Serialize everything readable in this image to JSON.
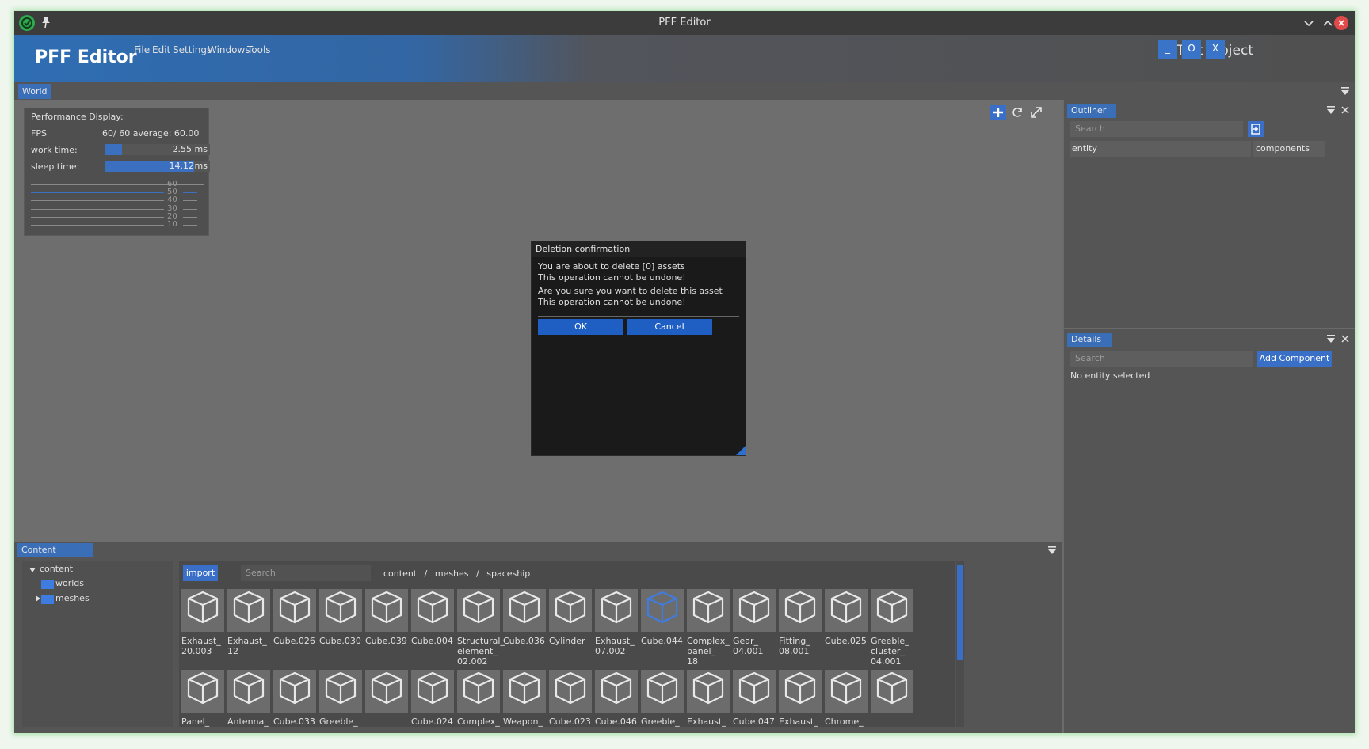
{
  "window": {
    "title": "PFF Editor"
  },
  "header": {
    "brand": "PFF Editor",
    "menu": [
      "File",
      "Edit",
      "Settings",
      "Windows",
      "Tools"
    ],
    "project": "Test Project",
    "buttons": {
      "minimize": "_",
      "maximize": "O",
      "close": "X"
    }
  },
  "world_tab": "World",
  "perf": {
    "title": "Performance Display:",
    "fps_label": "FPS",
    "fps_value": "60/  60   average: 60.00",
    "work_label": "work time:",
    "work_value": "2.55 ms",
    "work_fraction": 0.16,
    "sleep_label": "sleep time:",
    "sleep_value": "14.12",
    "sleep_unit": "ms",
    "sleep_fraction": 0.85,
    "graph_labels": [
      "60",
      "50",
      "40",
      "30",
      "20",
      "10"
    ]
  },
  "dialog": {
    "title": "Deletion confirmation",
    "line1": "You are about to delete [0] assets",
    "line2": "This operation cannot be undone!",
    "line3": "Are you sure you want to delete this asset",
    "line4": "This operation cannot be undone!",
    "ok": "OK",
    "cancel": "Cancel"
  },
  "outliner": {
    "tab": "Outliner",
    "search_placeholder": "Search",
    "col_entity": "entity",
    "col_components": "components"
  },
  "details": {
    "tab": "Details",
    "search_placeholder": "Search",
    "add_component": "Add Component",
    "empty": "No entity selected"
  },
  "content_browser": {
    "tab": "Content Browser",
    "tree": {
      "root": "content",
      "child1": "worlds",
      "child2": "meshes"
    },
    "import": "import",
    "search_placeholder": "Search",
    "breadcrumb": [
      "content",
      "/",
      "meshes",
      "/",
      "spaceship"
    ],
    "selected_index": 10,
    "row1": [
      "Exhaust_\n20.003",
      "Exhaust_\n12",
      "Cube.026",
      "Cube.030",
      "Cube.039",
      "Cube.004",
      "Structural_\nelement_\n02.002",
      "Cube.036",
      "Cylinder",
      "Exhaust_\n07.002",
      "Cube.044",
      "Complex_\npanel_\n18",
      "Gear_\n04.001",
      "Fitting_\n08.001",
      "Cube.025",
      "Greeble_\ncluster_\n04.001"
    ],
    "row2": [
      "Panel_",
      "Antenna_",
      "Cube.033",
      "Greeble_",
      "",
      "Cube.024",
      "Complex_",
      "Weapon_",
      "Cube.023",
      "Cube.046",
      "Greeble_",
      "Exhaust_",
      "Cube.047",
      "Exhaust_",
      "Chrome_",
      ""
    ]
  }
}
